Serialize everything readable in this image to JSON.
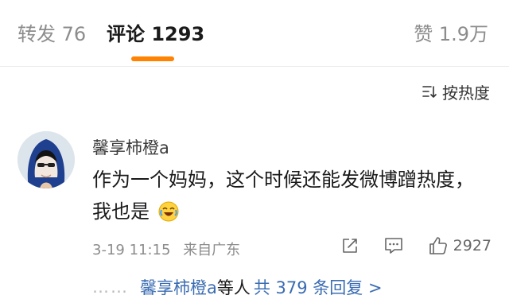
{
  "tabs": {
    "repost": "转发 76",
    "comment": "评论 1293",
    "like": "赞 1.9万"
  },
  "sort": {
    "label": "按热度"
  },
  "comment": {
    "username": "馨享柿橙a",
    "text_line1": "作为一个妈妈，这个时候还能发微博蹭热度，",
    "text_line2": "我也是",
    "emoji": "laughing-crying-emoji",
    "date": "3-19 11:15",
    "source": "来自广东",
    "like_count": "2927"
  },
  "replies": {
    "dots": "……",
    "name": "馨享柿橙a",
    "suffix": "等人",
    "count": "共 379 条回复 >"
  },
  "colors": {
    "accent": "#ff8200",
    "link": "#3b6db3",
    "muted": "#8c8c8c"
  }
}
